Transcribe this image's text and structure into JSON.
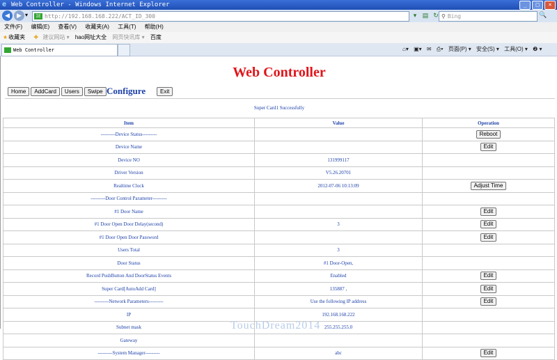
{
  "window": {
    "title": "Web Controller - Windows Internet Explorer"
  },
  "address": {
    "url": "http://192.168.168.222/ACT_ID_300",
    "search_placeholder": "Bing"
  },
  "menu": [
    "文件(F)",
    "编辑(E)",
    "查看(V)",
    "收藏夹(A)",
    "工具(T)",
    "帮助(H)"
  ],
  "favorites": {
    "label": "收藏夹",
    "items": [
      "建议网站 ▾",
      "hao网址大全",
      "网页快讯库 ▾",
      "百度"
    ]
  },
  "tab": {
    "label": "Web Controller"
  },
  "commandbar": {
    "page": "页面(P) ▾",
    "safety": "安全(S) ▾",
    "tools": "工具(O) ▾",
    "help": "❷ ▾"
  },
  "page": {
    "title": "Web Controller",
    "nav": [
      "Home",
      "AddCard",
      "Users",
      "Swipe"
    ],
    "heading": "Configure",
    "exit": "Exit",
    "message": "Super Card1 Successfully"
  },
  "table": {
    "headers": {
      "item": "Item",
      "value": "Value",
      "operation": "Operation"
    },
    "rows": [
      {
        "item": "---------Device Status---------",
        "value": "",
        "op": "Reboot"
      },
      {
        "item": "Device Name",
        "value": "",
        "op": "Edit"
      },
      {
        "item": "Device NO",
        "value": "131999117",
        "op": ""
      },
      {
        "item": "Driver Version",
        "value": "V5.26.20701",
        "op": ""
      },
      {
        "item": "Realtime Clock",
        "value": "2012-07-06 10:13:09",
        "op": "Adjust Time"
      },
      {
        "item": "---------Door Control Parameter---------",
        "value": "",
        "op": ""
      },
      {
        "item": "#1 Door Name",
        "value": "",
        "op": "Edit"
      },
      {
        "item": "#1 Door Open Door Delay(second)",
        "value": "3",
        "op": "Edit"
      },
      {
        "item": "#1 Door Open Door Password",
        "value": "",
        "op": "Edit"
      },
      {
        "item": "Users Total",
        "value": "3",
        "op": ""
      },
      {
        "item": "Door Status",
        "value": "#1 Door-Open,",
        "op": ""
      },
      {
        "item": "Record PushButton And DoorStatus Events",
        "value": "Enabled",
        "op": "Edit"
      },
      {
        "item": "Super Card[AutoAdd Card]",
        "value": "135887 ,",
        "op": "Edit"
      },
      {
        "item": "---------Network Parameters---------",
        "value": "Use the following IP address",
        "op": "Edit"
      },
      {
        "item": "IP",
        "value": "192.168.168.222",
        "op": ""
      },
      {
        "item": "Subnet mask",
        "value": "255.255.255.0",
        "op": ""
      },
      {
        "item": "Gateway",
        "value": "",
        "op": ""
      },
      {
        "item": "---------System Manager---------",
        "value": "abc",
        "op": "Edit"
      }
    ]
  },
  "watermark": "TouchDream2014"
}
